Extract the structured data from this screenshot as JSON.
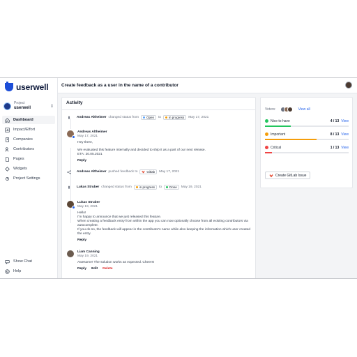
{
  "app": {
    "name": "userwell"
  },
  "project": {
    "label": "Project",
    "name": "userwell"
  },
  "nav": [
    {
      "label": "Dashboard",
      "icon": "home-icon",
      "active": true
    },
    {
      "label": "Impact/Effort",
      "icon": "chart-icon",
      "active": false
    },
    {
      "label": "Companies",
      "icon": "building-icon",
      "active": false
    },
    {
      "label": "Contributors",
      "icon": "users-icon",
      "active": false
    },
    {
      "label": "Pages",
      "icon": "pages-icon",
      "active": false
    },
    {
      "label": "Widgets",
      "icon": "widgets-icon",
      "active": false
    },
    {
      "label": "Project Settings",
      "icon": "gear-icon",
      "active": false
    }
  ],
  "bottom_nav": [
    {
      "label": "Show Chat",
      "icon": "chat-icon"
    },
    {
      "label": "Help",
      "icon": "help-icon"
    }
  ],
  "header": {
    "title": "Create feedback as a user in the name of a contributor"
  },
  "activity": {
    "title": "Activity",
    "event1": {
      "user": "Andreas Altheimer",
      "action": "changed status from",
      "from": "Open",
      "to_word": "to",
      "to": "in progress",
      "date": "May 17, 2021"
    },
    "comment1": {
      "author": "Andreas Altheimer",
      "date": "May 17, 2021",
      "line1": "Hey there,",
      "line2": "We evaluated this feature internally and decided to ship it as a part of our next release.",
      "line3": "ETA: 20.05.2021",
      "reply": "Reply"
    },
    "event2": {
      "user": "Andreas Altheimer",
      "action": "pushed feedback to",
      "target": "Gitlab",
      "date": "May 17, 2021"
    },
    "event3": {
      "user": "Lukas Struber",
      "action": "changed status from",
      "from": "in progress",
      "to_word": "to",
      "to": "Done",
      "date": "May 19, 2021"
    },
    "comment2": {
      "author": "Lukas Struber",
      "date": "May 19, 2021",
      "line1": "Hello!",
      "line2": "I'm happy to announce that we just released this feature.",
      "line3": "When creating a feedback entry from within the app you can now optionally choose from all existing contributors via autocomplete.",
      "line4": "If you do so, the feedback will appear in the contributor's name while also keeping the information which user created the entry.",
      "reply": "Reply"
    },
    "comment3": {
      "author": "Liam Canning",
      "date": "May 19, 2021",
      "line1": "Awesome! The solution works as expected. Cheers!",
      "reply": "Reply",
      "edit": "Edit",
      "delete": "Delete"
    }
  },
  "votes": {
    "voters_label": "Voters:",
    "view_all": "View all",
    "rows": [
      {
        "label": "Nice to have",
        "count": "4 / 13",
        "view": "View",
        "color": "#22c55e",
        "fraction": 0.31
      },
      {
        "label": "Important",
        "count": "8 / 13",
        "view": "View",
        "color": "#f59e0b",
        "fraction": 0.62
      },
      {
        "label": "Critical",
        "count": "1 / 13",
        "view": "View",
        "color": "#ef4444",
        "fraction": 0.08
      }
    ],
    "gitlab_button": "Create GitLab Issue"
  },
  "colors": {
    "brand": "#1d4ed8",
    "open": "#60a5fa",
    "in_progress": "#f59e0b",
    "done": "#22c55e",
    "gitlab": "#e24329"
  }
}
